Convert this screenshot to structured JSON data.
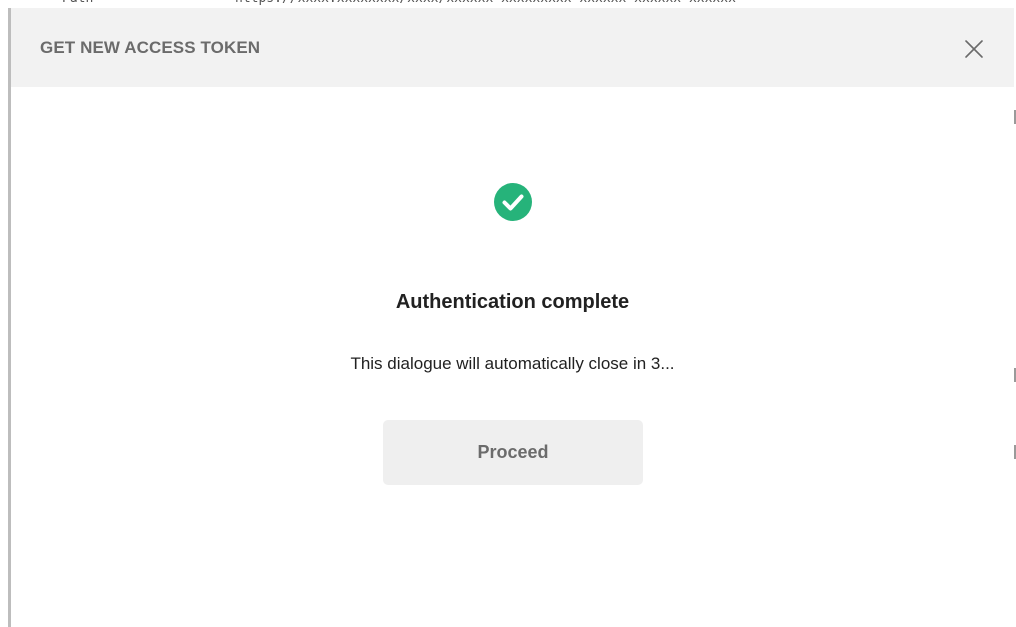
{
  "dialog": {
    "title": "GET NEW ACCESS TOKEN",
    "close_icon": "close-icon",
    "status_icon": "check-circle-icon",
    "heading": "Authentication complete",
    "message": "This dialogue will automatically close in 3...",
    "proceed_label": "Proceed"
  },
  "colors": {
    "success_green": "#26b37a",
    "header_bg": "#f2f2f2",
    "button_bg": "#efefef",
    "title_text": "#6b6b6b",
    "body_text": "#212121"
  }
}
